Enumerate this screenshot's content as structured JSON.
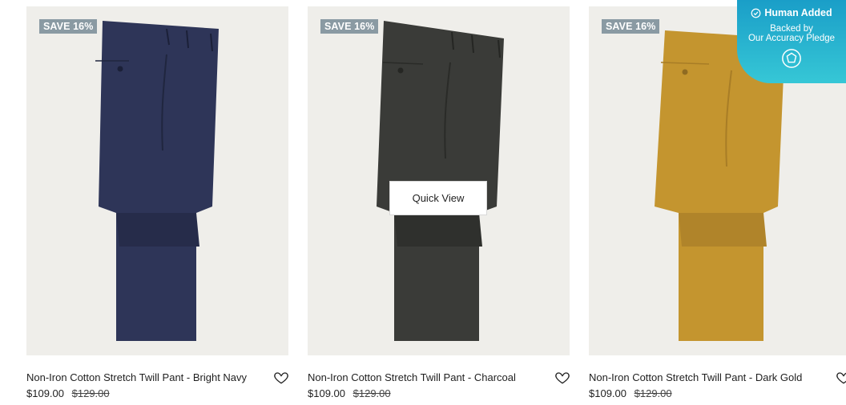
{
  "products": [
    {
      "badge": "SAVE 16%",
      "name": "Non-Iron Cotton Stretch Twill Pant - Bright Navy",
      "sale_price": "$109.00",
      "original_price": "$129.00",
      "color": "#2e3558"
    },
    {
      "badge": "SAVE 16%",
      "name": "Non-Iron Cotton Stretch Twill Pant - Charcoal",
      "sale_price": "$109.00",
      "original_price": "$129.00",
      "color": "#3a3b38",
      "quick_view_label": "Quick View"
    },
    {
      "badge": "SAVE 16%",
      "name": "Non-Iron Cotton Stretch Twill Pant - Dark Gold",
      "sale_price": "$109.00",
      "original_price": "$129.00",
      "color": "#c4952f"
    }
  ],
  "pledge": {
    "title": "Human Added",
    "line1": "Backed by",
    "line2": "Our Accuracy Pledge"
  },
  "icons": {
    "wishlist": "heart-icon",
    "pledge_check": "check-circle-icon",
    "pledge_shield": "shield-icon"
  }
}
